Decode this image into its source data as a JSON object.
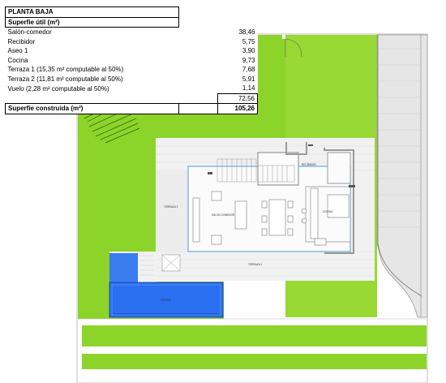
{
  "table": {
    "title": "PLANTA BAJA",
    "useful_header": "Superfie útil (m²)",
    "rows": [
      {
        "label": "Salón-comedor",
        "value": "38,46"
      },
      {
        "label": "Recibidor",
        "value": "5,75"
      },
      {
        "label": "Aseo 1",
        "value": "3,90"
      },
      {
        "label": "Cocina",
        "value": "9,73"
      },
      {
        "label": "Terraza 1 (15,35 m² computable al 50%)",
        "value": "7,68"
      },
      {
        "label": "Terraza 2 (11,81 m² computable al 50%)",
        "value": "5,91"
      },
      {
        "label": "Vuelo (2,28 m² computable al 50%)",
        "value": "1,14"
      }
    ],
    "useful_total": "72,56",
    "built_label": "Superfie construida (m²)",
    "built_value": "105,26"
  },
  "plan_labels": {
    "recibidor": "RECIBIDOR",
    "salon_comedor": "SALON COMEDOR",
    "cocina": "COCINA",
    "terraza_1": "TERRAZA 1",
    "terraza_2": "TERRAZA 2",
    "piscina": "PISCINA"
  },
  "colors": {
    "lawn": "#8cd42a",
    "lawn_light": "#a6df3e",
    "pool": "#2a6ff0",
    "road": "#e9e9e9",
    "wall": "#9a9a9a",
    "wall_blue": "#7fb3e6"
  }
}
